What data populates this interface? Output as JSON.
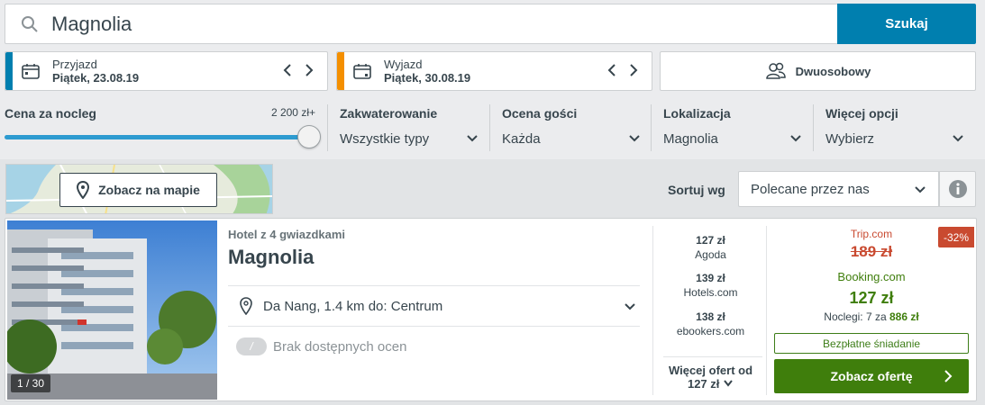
{
  "search": {
    "query": "Magnolia",
    "button_label": "Szukaj"
  },
  "checkin": {
    "label": "Przyjazd",
    "value": "Piątek, 23.08.19",
    "accent": "#007faf"
  },
  "checkout": {
    "label": "Wyjazd",
    "value": "Piątek, 30.08.19",
    "accent": "#f48f00"
  },
  "room": {
    "label": "Dwuosobowy"
  },
  "filters": {
    "price": {
      "title": "Cena za nocleg",
      "max": "2 200 zł+",
      "level": 1.0
    },
    "accommodation": {
      "title": "Zakwaterowanie",
      "value": "Wszystkie typy"
    },
    "rating": {
      "title": "Ocena gości",
      "value": "Każda"
    },
    "location": {
      "title": "Lokalizacja",
      "value": "Magnolia"
    },
    "more": {
      "title": "Więcej opcji",
      "value": "Wybierz"
    }
  },
  "map": {
    "button_label": "Zobacz na mapie"
  },
  "sort": {
    "label": "Sortuj wg",
    "value": "Polecane przez nas"
  },
  "hotel": {
    "stars_label": "Hotel z 4 gwiazdkami",
    "name": "Magnolia",
    "location": "Da Nang, 1.4 km do: Centrum",
    "rating_badge": "/",
    "rating_text": "Brak dostępnych ocen",
    "photo_count": "1 / 30",
    "offers": [
      {
        "price": "127 zł",
        "site": "Agoda"
      },
      {
        "price": "139 zł",
        "site": "Hotels.com"
      },
      {
        "price": "138 zł",
        "site": "ebookers.com"
      }
    ],
    "more_offers_label": "Więcej ofert od",
    "more_offers_price": "127 zł",
    "deal": {
      "old_site": "Trip.com",
      "old_price": "189 zł",
      "discount": "-32%",
      "site": "Booking.com",
      "price": "127 zł",
      "nights_label": "Noclegi: 7 za",
      "nights_total": "886 zł",
      "breakfast": "Bezpłatne śniadanie",
      "cta": "Zobacz ofertę"
    }
  },
  "colors": {
    "primary": "#007faf",
    "green": "#3f7e0c",
    "red": "#c94a30",
    "orange": "#f48f00"
  }
}
